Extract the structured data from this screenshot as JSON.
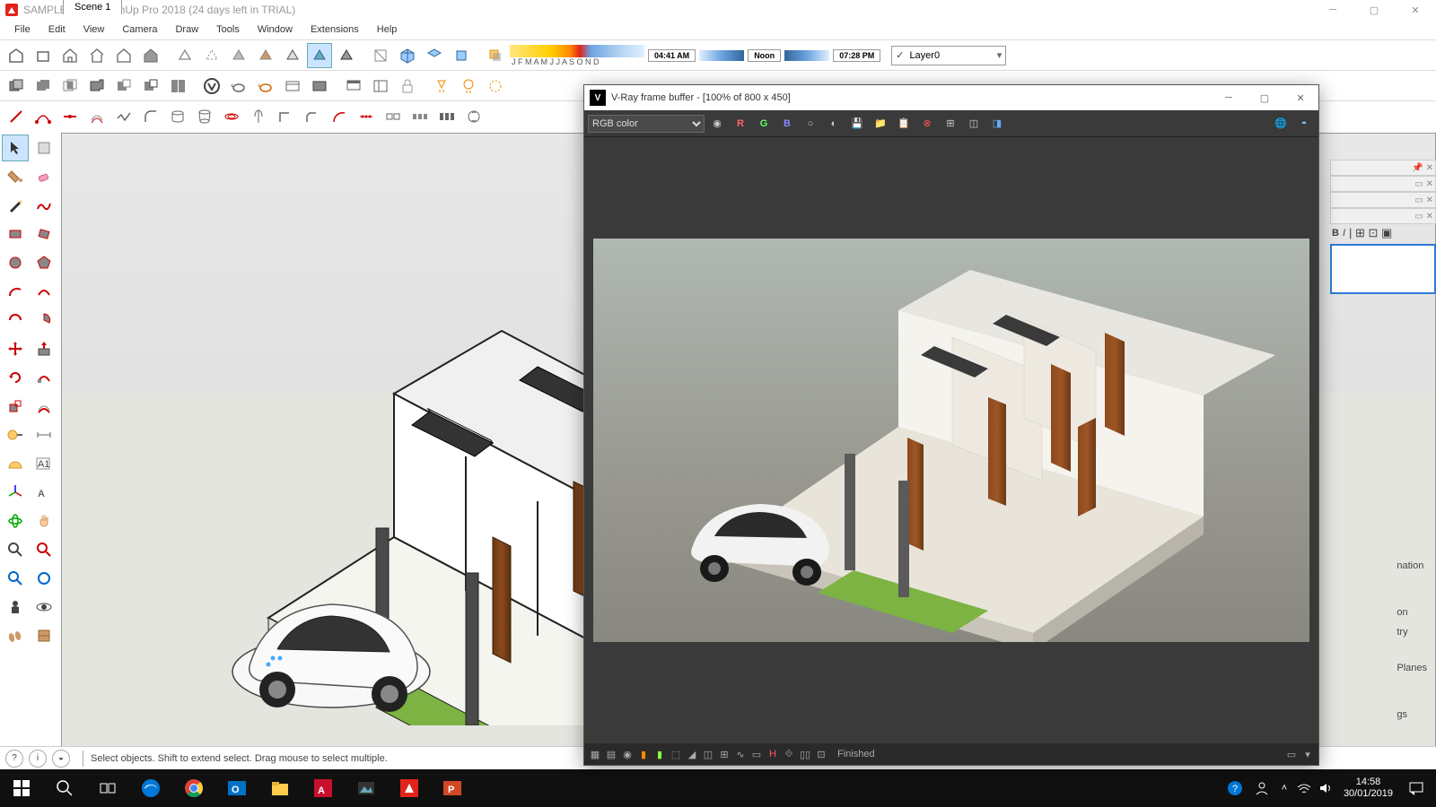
{
  "titlebar": {
    "title": "SAMPLE 7A - SketchUp Pro 2018 (24 days left in TRIAL)"
  },
  "menu": [
    "File",
    "Edit",
    "View",
    "Camera",
    "Draw",
    "Tools",
    "Window",
    "Extensions",
    "Help"
  ],
  "shadow": {
    "months": "J F M A M J J A S O N D",
    "t1": "04:41 AM",
    "t2": "Noon",
    "t3": "07:28 PM"
  },
  "layer": {
    "name": "Layer0"
  },
  "scene": {
    "tab": "Scene 1"
  },
  "status": {
    "hint": "Select objects. Shift to extend select. Drag mouse to select multiple."
  },
  "vray": {
    "title": "V-Ray frame buffer - [100% of 800 x 450]",
    "mode": "RGB color",
    "status": "Finished"
  },
  "panels": {
    "l1": "nation",
    "l2": "on",
    "l3": "try",
    "l4": "Planes",
    "l5": "gs"
  },
  "taskbar": {
    "time": "14:58",
    "date": "30/01/2019"
  }
}
